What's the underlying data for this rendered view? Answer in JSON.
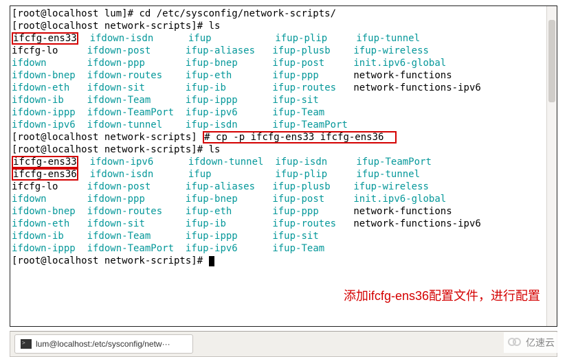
{
  "prompt_user": "root",
  "prompt_host": "localhost",
  "lines": {
    "l1_prompt": "[root@localhost lum]# ",
    "l1_cmd": "cd /etc/sysconfig/network-scripts/",
    "l2_prompt": "[root@localhost network-scripts]# ",
    "l2_cmd": "ls",
    "list1": {
      "r1": {
        "c1": "ifcfg-ens33",
        "c2": "ifdown-isdn",
        "c3": "ifup",
        "c4": "ifup-plip",
        "c5": "ifup-tunnel"
      },
      "r2": {
        "c1": "ifcfg-lo",
        "c2": "ifdown-post",
        "c3": "ifup-aliases",
        "c4": "ifup-plusb",
        "c5": "ifup-wireless"
      },
      "r3": {
        "c1": "ifdown",
        "c2": "ifdown-ppp",
        "c3": "ifup-bnep",
        "c4": "ifup-post",
        "c5": "init.ipv6-global"
      },
      "r4": {
        "c1": "ifdown-bnep",
        "c2": "ifdown-routes",
        "c3": "ifup-eth",
        "c4": "ifup-ppp",
        "c5": "network-functions"
      },
      "r5": {
        "c1": "ifdown-eth",
        "c2": "ifdown-sit",
        "c3": "ifup-ib",
        "c4": "ifup-routes",
        "c5": "network-functions-ipv6"
      },
      "r6": {
        "c1": "ifdown-ib",
        "c2": "ifdown-Team",
        "c3": "ifup-ippp",
        "c4": "ifup-sit",
        "c5": ""
      },
      "r7": {
        "c1": "ifdown-ippp",
        "c2": "ifdown-TeamPort",
        "c3": "ifup-ipv6",
        "c4": "ifup-Team",
        "c5": ""
      },
      "r8": {
        "c1": "ifdown-ipv6",
        "c2": "ifdown-tunnel",
        "c3": "ifup-isdn",
        "c4": "ifup-TeamPort",
        "c5": ""
      }
    },
    "l3_full": "[root@localhost network-scripts]# cp -p ifcfg-ens33 ifcfg-ens36",
    "l3_cmd": "# cp -p ifcfg-ens33 ifcfg-ens36",
    "l3_prompt_part": "[root@localhost network-scripts]",
    "l4_prompt": "[root@localhost network-scripts]# ",
    "l4_cmd": "ls",
    "list2": {
      "r1": {
        "c1": "ifcfg-ens33",
        "c2": "ifdown-ipv6",
        "c3": "ifdown-tunnel",
        "c4": "ifup-isdn",
        "c5": "ifup-TeamPort"
      },
      "r2": {
        "c1": "ifcfg-ens36",
        "c2": "ifdown-isdn",
        "c3": "ifup",
        "c4": "ifup-plip",
        "c5": "ifup-tunnel"
      },
      "r3": {
        "c1": "ifcfg-lo",
        "c2": "ifdown-post",
        "c3": "ifup-aliases",
        "c4": "ifup-plusb",
        "c5": "ifup-wireless"
      },
      "r4": {
        "c1": "ifdown",
        "c2": "ifdown-ppp",
        "c3": "ifup-bnep",
        "c4": "ifup-post",
        "c5": "init.ipv6-global"
      },
      "r5": {
        "c1": "ifdown-bnep",
        "c2": "ifdown-routes",
        "c3": "ifup-eth",
        "c4": "ifup-ppp",
        "c5": "network-functions"
      },
      "r6": {
        "c1": "ifdown-eth",
        "c2": "ifdown-sit",
        "c3": "ifup-ib",
        "c4": "ifup-routes",
        "c5": "network-functions-ipv6"
      },
      "r7": {
        "c1": "ifdown-ib",
        "c2": "ifdown-Team",
        "c3": "ifup-ippp",
        "c4": "ifup-sit",
        "c5": ""
      },
      "r8": {
        "c1": "ifdown-ippp",
        "c2": "ifdown-TeamPort",
        "c3": "ifup-ipv6",
        "c4": "ifup-Team",
        "c5": ""
      }
    },
    "l5_prompt": "[root@localhost network-scripts]# "
  },
  "col_widths": {
    "c1": 13,
    "c2": 17,
    "c3": 15,
    "c4": 14,
    "c5": 0
  },
  "list1_colors": {
    "r1": {
      "c1": "bk",
      "c2": "cy",
      "c3": "cy",
      "c4": "cy",
      "c5": "cy"
    },
    "r2": {
      "c1": "bk",
      "c2": "cy",
      "c3": "cy",
      "c4": "cy",
      "c5": "cy"
    },
    "r3": {
      "c1": "cy",
      "c2": "cy",
      "c3": "cy",
      "c4": "cy",
      "c5": "cy"
    },
    "r4": {
      "c1": "cy",
      "c2": "cy",
      "c3": "cy",
      "c4": "cy",
      "c5": "bk"
    },
    "r5": {
      "c1": "cy",
      "c2": "cy",
      "c3": "cy",
      "c4": "cy",
      "c5": "bk"
    },
    "r6": {
      "c1": "cy",
      "c2": "cy",
      "c3": "cy",
      "c4": "cy",
      "c5": "bk"
    },
    "r7": {
      "c1": "cy",
      "c2": "cy",
      "c3": "cy",
      "c4": "cy",
      "c5": "bk"
    },
    "r8": {
      "c1": "cy",
      "c2": "cy",
      "c3": "cy",
      "c4": "cy",
      "c5": "bk"
    }
  },
  "list2_colors": {
    "r1": {
      "c1": "bk",
      "c2": "cy",
      "c3": "cy",
      "c4": "cy",
      "c5": "cy"
    },
    "r2": {
      "c1": "bk",
      "c2": "cy",
      "c3": "cy",
      "c4": "cy",
      "c5": "cy"
    },
    "r3": {
      "c1": "bk",
      "c2": "cy",
      "c3": "cy",
      "c4": "cy",
      "c5": "cy"
    },
    "r4": {
      "c1": "cy",
      "c2": "cy",
      "c3": "cy",
      "c4": "cy",
      "c5": "cy"
    },
    "r5": {
      "c1": "cy",
      "c2": "cy",
      "c3": "cy",
      "c4": "cy",
      "c5": "bk"
    },
    "r6": {
      "c1": "cy",
      "c2": "cy",
      "c3": "cy",
      "c4": "cy",
      "c5": "bk"
    },
    "r7": {
      "c1": "cy",
      "c2": "cy",
      "c3": "cy",
      "c4": "cy",
      "c5": "bk"
    },
    "r8": {
      "c1": "cy",
      "c2": "cy",
      "c3": "cy",
      "c4": "cy",
      "c5": "bk"
    }
  },
  "redboxes": [
    "list1.r1.c1",
    "l3_cmd",
    "list2.r1.c1",
    "list2.r2.c1"
  ],
  "annotation": "添加ifcfg-ens36配置文件，进行配置",
  "taskbar_title": "lum@localhost:/etc/sysconfig/netw···",
  "watermark_text": "亿速云"
}
